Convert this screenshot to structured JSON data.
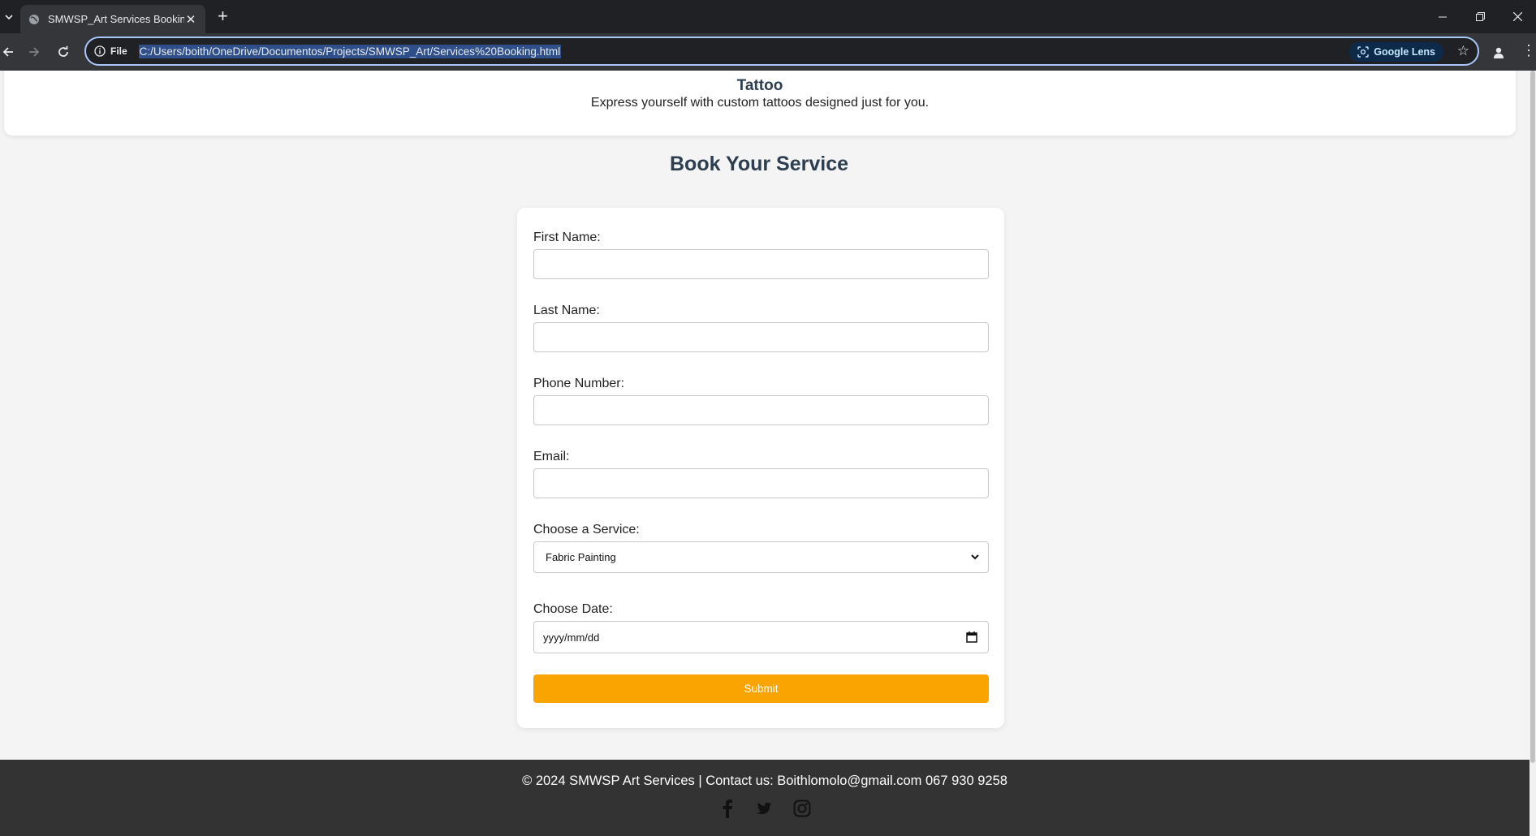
{
  "browser": {
    "tab_title": "SMWSP_Art Services Booking",
    "site_info_label": "File",
    "url": "C:/Users/boith/OneDrive/Documentos/Projects/SMWSP_Art/Services%20Booking.html",
    "lens_label": "Google Lens"
  },
  "service": {
    "title": "Tattoo",
    "description": "Express yourself with custom tattoos designed just for you."
  },
  "booking": {
    "heading": "Book Your Service",
    "first_name_label": "First Name:",
    "first_name_value": "",
    "last_name_label": "Last Name:",
    "last_name_value": "",
    "phone_label": "Phone Number:",
    "phone_value": "",
    "email_label": "Email:",
    "email_value": "",
    "service_label": "Choose a Service:",
    "service_selected": "Fabric Painting",
    "date_label": "Choose Date:",
    "date_placeholder": "yyyy/mm/dd",
    "submit_label": "Submit"
  },
  "footer": {
    "text": "© 2024 SMWSP Art Services | Contact us: Boithlomolo@gmail.com 067 930 9258",
    "social_icons": [
      "facebook-icon",
      "twitter-icon",
      "instagram-icon"
    ]
  },
  "colors": {
    "accent": "#f9a400",
    "heading": "#2c3e50",
    "footer_bg": "#333333",
    "page_bg": "#f4f4f4"
  }
}
